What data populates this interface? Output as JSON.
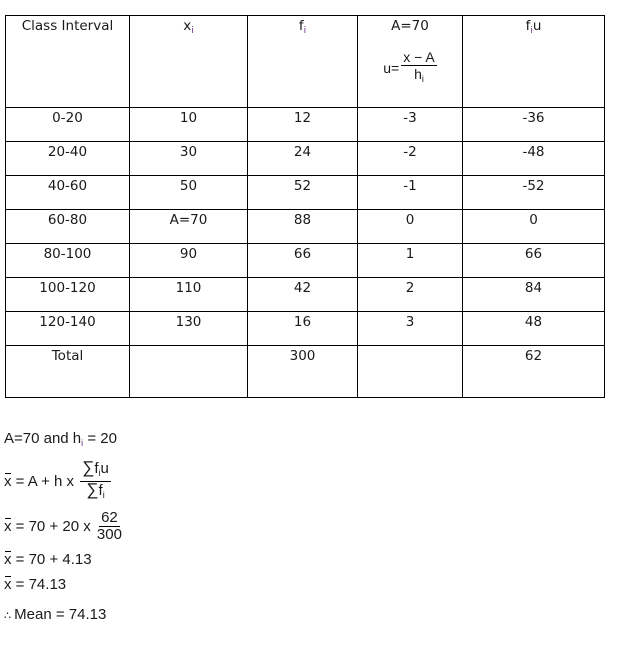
{
  "table": {
    "headers": {
      "class_interval": "Class Interval",
      "xi_base": "x",
      "xi_sub": "i",
      "fi_base": "f",
      "fi_sub": "i",
      "assumed_mean": "A=70",
      "u_label": "u=",
      "u_num": "x − A",
      "u_den_base": "h",
      "u_den_sub": "i",
      "fiu_f": "f",
      "fiu_sub": "i",
      "fiu_u": "u"
    },
    "rows": [
      {
        "ci": "0-20",
        "xi": "10",
        "fi": "12",
        "u": "-3",
        "fiu": "-36"
      },
      {
        "ci": "20-40",
        "xi": "30",
        "fi": "24",
        "u": "-2",
        "fiu": "-48"
      },
      {
        "ci": "40-60",
        "xi": "50",
        "fi": "52",
        "u": "-1",
        "fiu": "-52"
      },
      {
        "ci": "60-80",
        "xi": "A=70",
        "fi": "88",
        "u": "0",
        "fiu": "0"
      },
      {
        "ci": "80-100",
        "xi": "90",
        "fi": "66",
        "u": "1",
        "fiu": "66"
      },
      {
        "ci": "100-120",
        "xi": "110",
        "fi": "42",
        "u": "2",
        "fiu": "84"
      },
      {
        "ci": "120-140",
        "xi": "130",
        "fi": "16",
        "u": "3",
        "fiu": "48"
      }
    ],
    "total": {
      "label": "Total",
      "xi": "",
      "fi": "300",
      "u": "",
      "fiu": "62"
    }
  },
  "work": {
    "line1_a": "A=70 and h",
    "line1_sub": "i",
    "line1_b": " = 20",
    "formula_lhs": "x",
    "formula_eq": " = A + h x ",
    "formula_num_sigma": "∑",
    "formula_num_f": "f",
    "formula_num_sub": "i",
    "formula_num_u": "u",
    "formula_den_sigma": "∑",
    "formula_den_f": "f",
    "formula_den_sub": "i",
    "step1_eq": " = 70 + 20 x ",
    "step1_num": "62",
    "step1_den": "300",
    "step2_eq": " = 70 + 4.13",
    "step3_eq": " = 74.13",
    "therefore": "∴",
    "conclusion": " Mean = 74.13"
  }
}
